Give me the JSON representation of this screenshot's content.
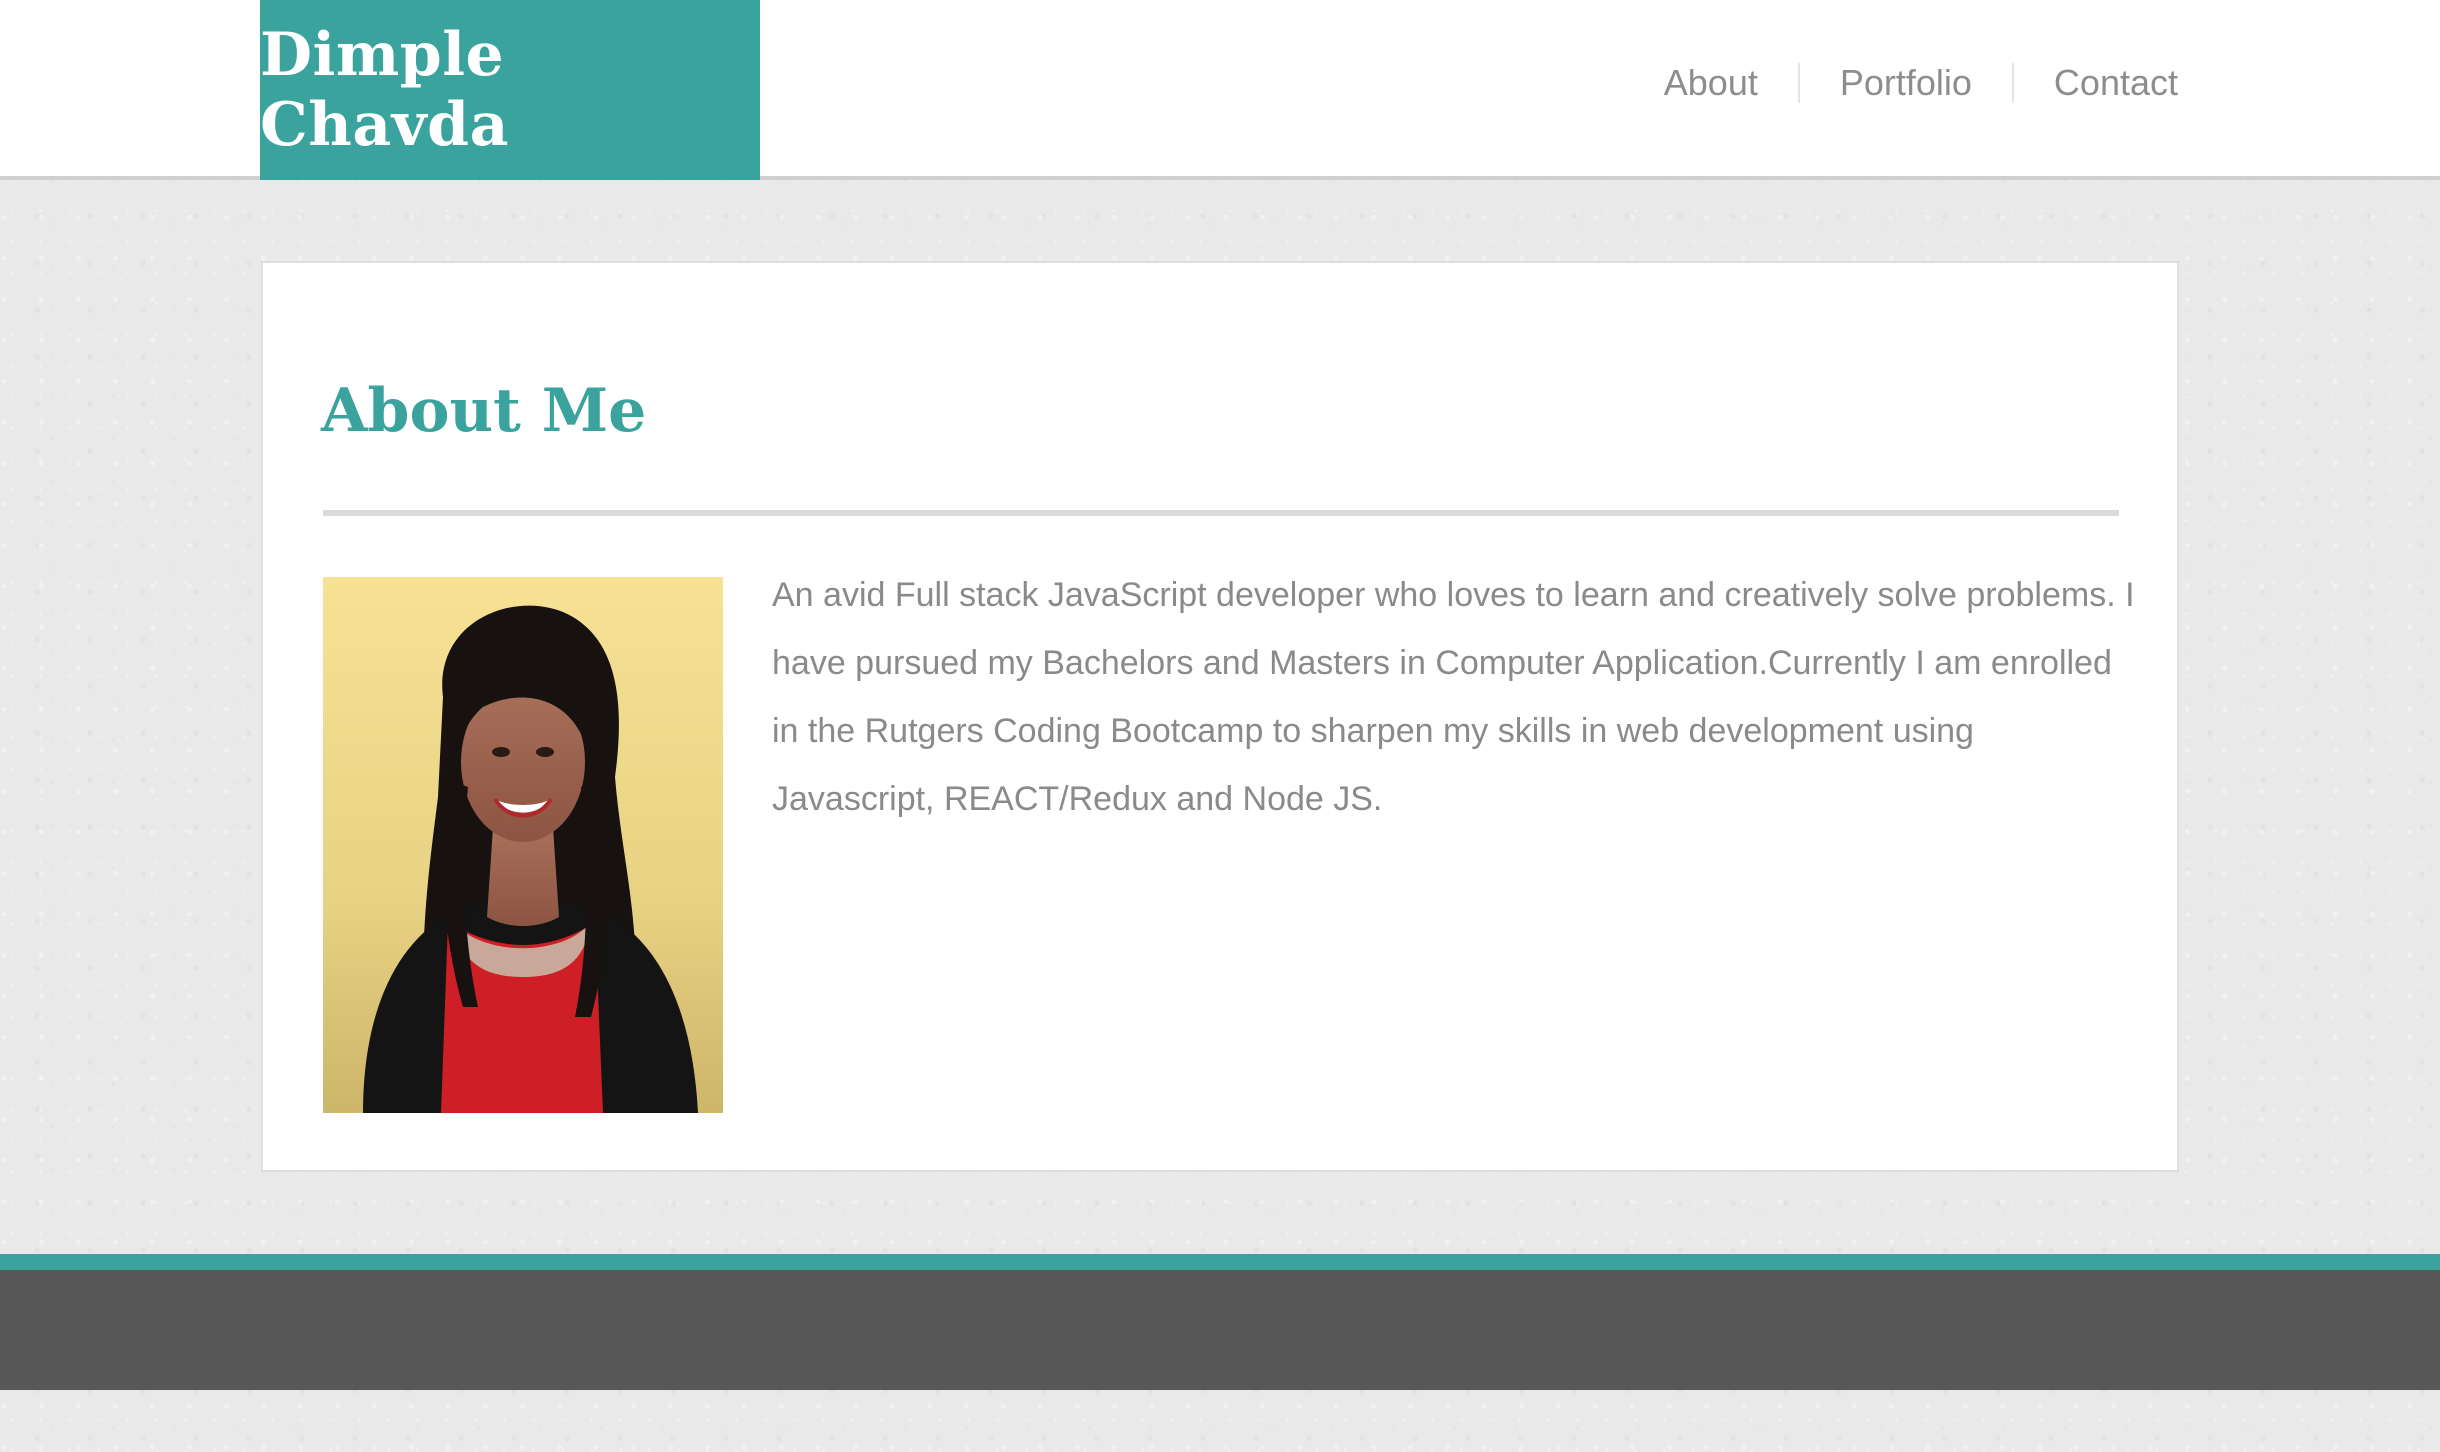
{
  "header": {
    "brand": "Dimple Chavda",
    "nav": [
      "About",
      "Portfolio",
      "Contact"
    ]
  },
  "about": {
    "title": "About Me",
    "bio": "An avid Full stack JavaScript developer who loves to learn and creatively solve problems. I have pursued my Bachelors and Masters in Computer Application.Currently I am enrolled in the Rutgers Coding Bootcamp to sharpen my skills in web development using Javascript, REACT/Redux and Node JS."
  },
  "colors": {
    "accent": "#3aa39e",
    "footer": "#585858",
    "text": "#8a8a8a"
  }
}
